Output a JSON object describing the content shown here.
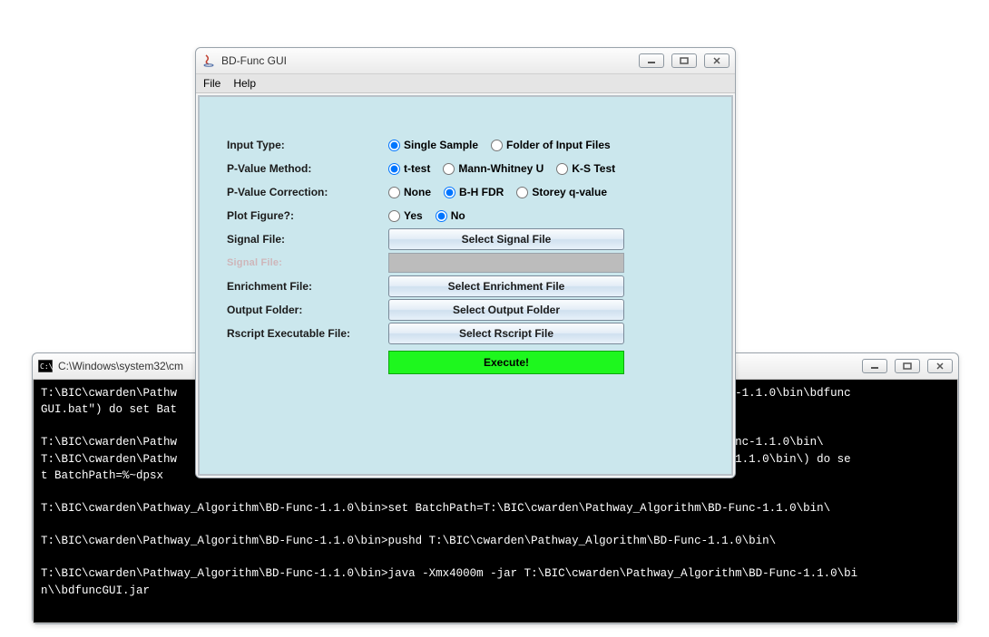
{
  "console": {
    "title": "C:\\Windows\\system32\\cm",
    "lines": [
      "T:\\BIC\\cwarden\\Pathw                                                                          \\BD-Func-1.1.0\\bin\\bdfunc",
      "GUI.bat\") do set Bat",
      "",
      "T:\\BIC\\cwarden\\Pathw                                                                          hm\\BD-Func-1.1.0\\bin\\",
      "T:\\BIC\\cwarden\\Pathw                                                                          BD-Func-1.1.0\\bin\\) do se",
      "t BatchPath=%~dpsx",
      "",
      "T:\\BIC\\cwarden\\Pathway_Algorithm\\BD-Func-1.1.0\\bin>set BatchPath=T:\\BIC\\cwarden\\Pathway_Algorithm\\BD-Func-1.1.0\\bin\\",
      "",
      "T:\\BIC\\cwarden\\Pathway_Algorithm\\BD-Func-1.1.0\\bin>pushd T:\\BIC\\cwarden\\Pathway_Algorithm\\BD-Func-1.1.0\\bin\\",
      "",
      "T:\\BIC\\cwarden\\Pathway_Algorithm\\BD-Func-1.1.0\\bin>java -Xmx4000m -jar T:\\BIC\\cwarden\\Pathway_Algorithm\\BD-Func-1.1.0\\bi",
      "n\\\\bdfuncGUI.jar"
    ]
  },
  "gui": {
    "title": "BD-Func GUI",
    "menu": {
      "file": "File",
      "help": "Help"
    },
    "labels": {
      "inputType": "Input Type:",
      "pvalueMethod": "P-Value Method:",
      "pvalueCorrection": "P-Value Correction:",
      "plotFigure": "Plot Figure?:",
      "signalFile": "Signal File:",
      "signalFileHint": "Signal File:",
      "enrichmentFile": "Enrichment File:",
      "outputFolder": "Output Folder:",
      "rscript": "Rscript Executable File:"
    },
    "radios": {
      "inputType": {
        "single": "Single Sample",
        "folder": "Folder of Input Files"
      },
      "pvalueMethod": {
        "ttest": "t-test",
        "mann": "Mann-Whitney U",
        "ks": "K-S Test"
      },
      "pvalueCorrection": {
        "none": "None",
        "bhfdr": "B-H FDR",
        "storey": "Storey q-value"
      },
      "plotFigure": {
        "yes": "Yes",
        "no": "No"
      }
    },
    "buttons": {
      "signal": "Select Signal File",
      "enrichment": "Select Enrichment File",
      "output": "Select Output Folder",
      "rscript": "Select Rscript File",
      "execute": "Execute!"
    }
  }
}
